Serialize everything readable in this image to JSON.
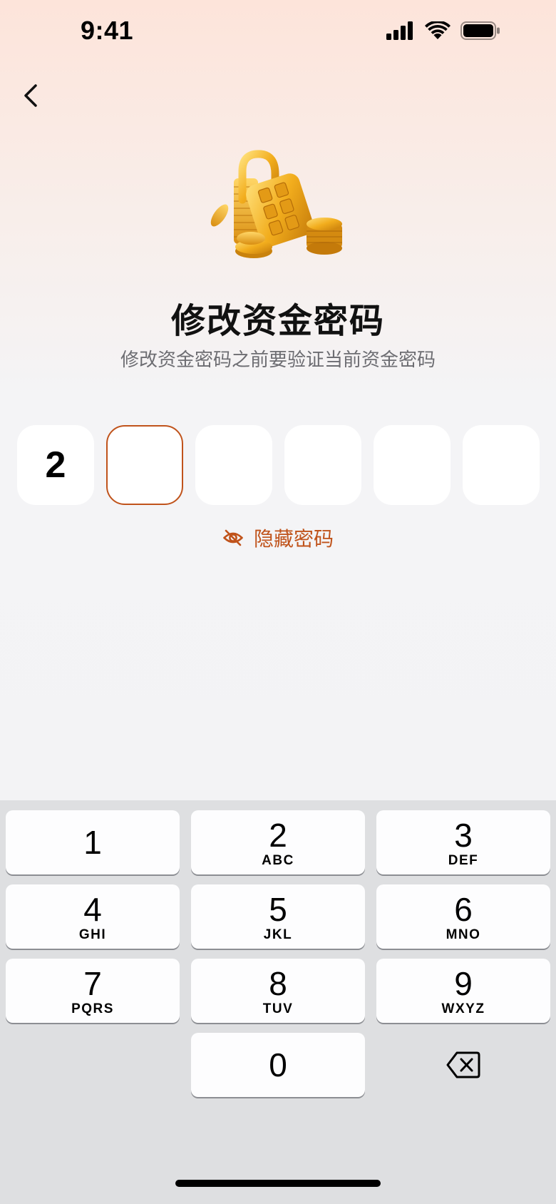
{
  "status_bar": {
    "time": "9:41"
  },
  "page": {
    "title": "修改资金密码",
    "subtitle": "修改资金密码之前要验证当前资金密码",
    "pin_digits": [
      "2",
      "",
      "",
      "",
      "",
      ""
    ],
    "active_index": 1,
    "toggle_label": "隐藏密码"
  },
  "colors": {
    "accent": "#c0531b",
    "background_top": "#fde4da",
    "keyboard_bg": "#dedfe1"
  },
  "keypad": {
    "keys": [
      {
        "num": "1",
        "letters": ""
      },
      {
        "num": "2",
        "letters": "ABC"
      },
      {
        "num": "3",
        "letters": "DEF"
      },
      {
        "num": "4",
        "letters": "GHI"
      },
      {
        "num": "5",
        "letters": "JKL"
      },
      {
        "num": "6",
        "letters": "MNO"
      },
      {
        "num": "7",
        "letters": "PQRS"
      },
      {
        "num": "8",
        "letters": "TUV"
      },
      {
        "num": "9",
        "letters": "WXYZ"
      },
      {
        "num": "0",
        "letters": ""
      }
    ]
  }
}
